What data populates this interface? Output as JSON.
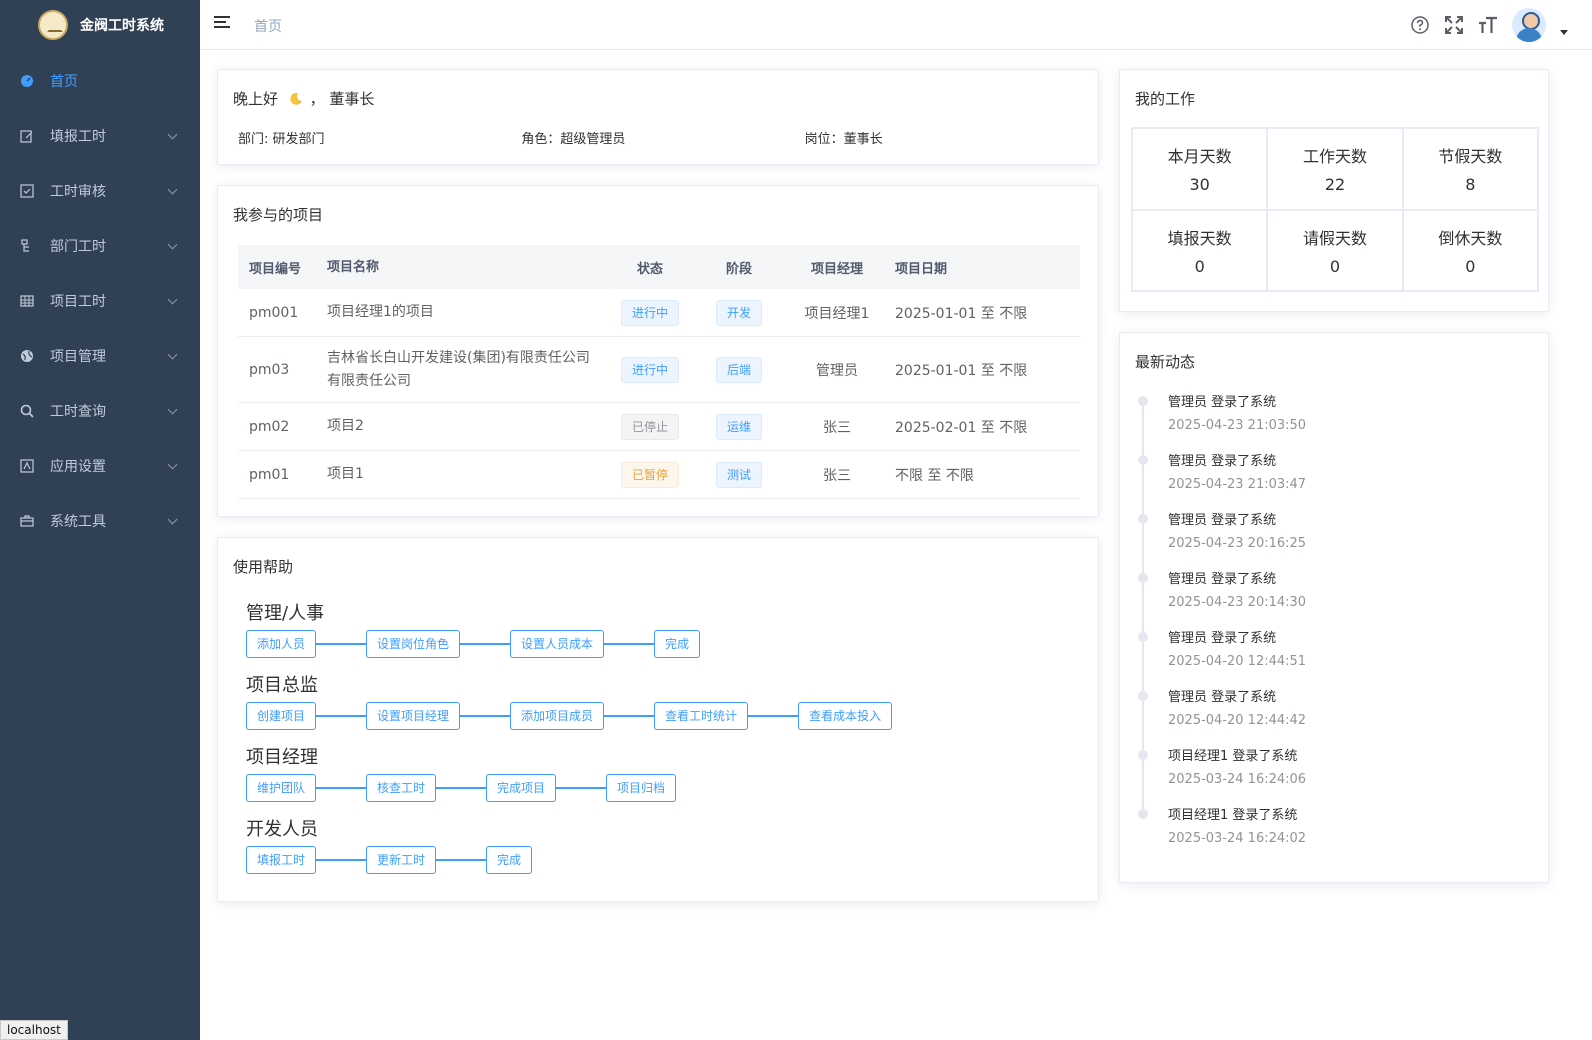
{
  "app": {
    "title": "金阀工时系统"
  },
  "sidebar": {
    "items": [
      {
        "label": "首页",
        "icon": "dashboard-icon",
        "active": true
      },
      {
        "label": "填报工时",
        "icon": "edit-icon"
      },
      {
        "label": "工时审核",
        "icon": "checkbox-icon"
      },
      {
        "label": "部门工时",
        "icon": "tree-icon"
      },
      {
        "label": "项目工时",
        "icon": "table-icon"
      },
      {
        "label": "项目管理",
        "icon": "globe-icon"
      },
      {
        "label": "工时查询",
        "icon": "search-icon"
      },
      {
        "label": "应用设置",
        "icon": "settings-icon"
      },
      {
        "label": "系统工具",
        "icon": "toolbox-icon"
      }
    ]
  },
  "navbar": {
    "breadcrumb": "首页"
  },
  "greeting": {
    "text": "晚上好",
    "name": "，  董事长",
    "dept": "部门: 研发部门",
    "role": "角色：超级管理员",
    "post": "岗位：董事长"
  },
  "projects": {
    "title": "我参与的项目",
    "headers": [
      "项目编号",
      "项目名称",
      "状态",
      "阶段",
      "项目经理",
      "项目日期"
    ],
    "rows": [
      {
        "id": "pm001",
        "name": "项目经理1的项目",
        "status": "进行中",
        "stage": "开发",
        "manager": "项目经理1",
        "date": "2025-01-01 至 不限"
      },
      {
        "id": "pm03",
        "name": "吉林省长白山开发建设(集团)有限责任公司",
        "name2": "有限责任公司",
        "status": "进行中",
        "stage": "后端",
        "manager": "管理员",
        "date": "2025-01-01 至 不限"
      },
      {
        "id": "pm02",
        "name": "项目2",
        "status": "已停止",
        "stage": "运维",
        "manager": "张三",
        "date": "2025-02-01 至 不限"
      },
      {
        "id": "pm01",
        "name": "项目1",
        "status": "已暂停",
        "stage": "测试",
        "manager": "张三",
        "date": "不限 至 不限"
      }
    ]
  },
  "help": {
    "title": "使用帮助",
    "groups": [
      {
        "title": "管理/人事",
        "steps": [
          "添加人员",
          "设置岗位角色",
          "设置人员成本",
          "完成"
        ]
      },
      {
        "title": "项目总监",
        "steps": [
          "创建项目",
          "设置项目经理",
          "添加项目成员",
          "查看工时统计",
          "查看成本投入"
        ]
      },
      {
        "title": "项目经理",
        "steps": [
          "维护团队",
          "核查工时",
          "完成项目",
          "项目归档"
        ]
      },
      {
        "title": "开发人员",
        "steps": [
          "填报工时",
          "更新工时",
          "完成"
        ]
      }
    ]
  },
  "mywork": {
    "title": "我的工作",
    "stats": [
      {
        "label": "本月天数",
        "value": "30"
      },
      {
        "label": "工作天数",
        "value": "22"
      },
      {
        "label": "节假天数",
        "value": "8"
      },
      {
        "label": "填报天数",
        "value": "0"
      },
      {
        "label": "请假天数",
        "value": "0"
      },
      {
        "label": "倒休天数",
        "value": "0"
      }
    ]
  },
  "news": {
    "title": "最新动态",
    "items": [
      {
        "text": "管理员 登录了系统",
        "time": "2025-04-23 21:03:50"
      },
      {
        "text": "管理员 登录了系统",
        "time": "2025-04-23 21:03:47"
      },
      {
        "text": "管理员 登录了系统",
        "time": "2025-04-23 20:16:25"
      },
      {
        "text": "管理员 登录了系统",
        "time": "2025-04-23 20:14:30"
      },
      {
        "text": "管理员 登录了系统",
        "time": "2025-04-20 12:44:51"
      },
      {
        "text": "管理员 登录了系统",
        "time": "2025-04-20 12:44:42"
      },
      {
        "text": "项目经理1 登录了系统",
        "time": "2025-03-24 16:24:06"
      },
      {
        "text": "项目经理1 登录了系统",
        "time": "2025-03-24 16:24:02"
      }
    ]
  },
  "statusbar": {
    "text": "localhost"
  },
  "colors": {
    "sidebar": "#304156",
    "accent": "#409eff"
  }
}
